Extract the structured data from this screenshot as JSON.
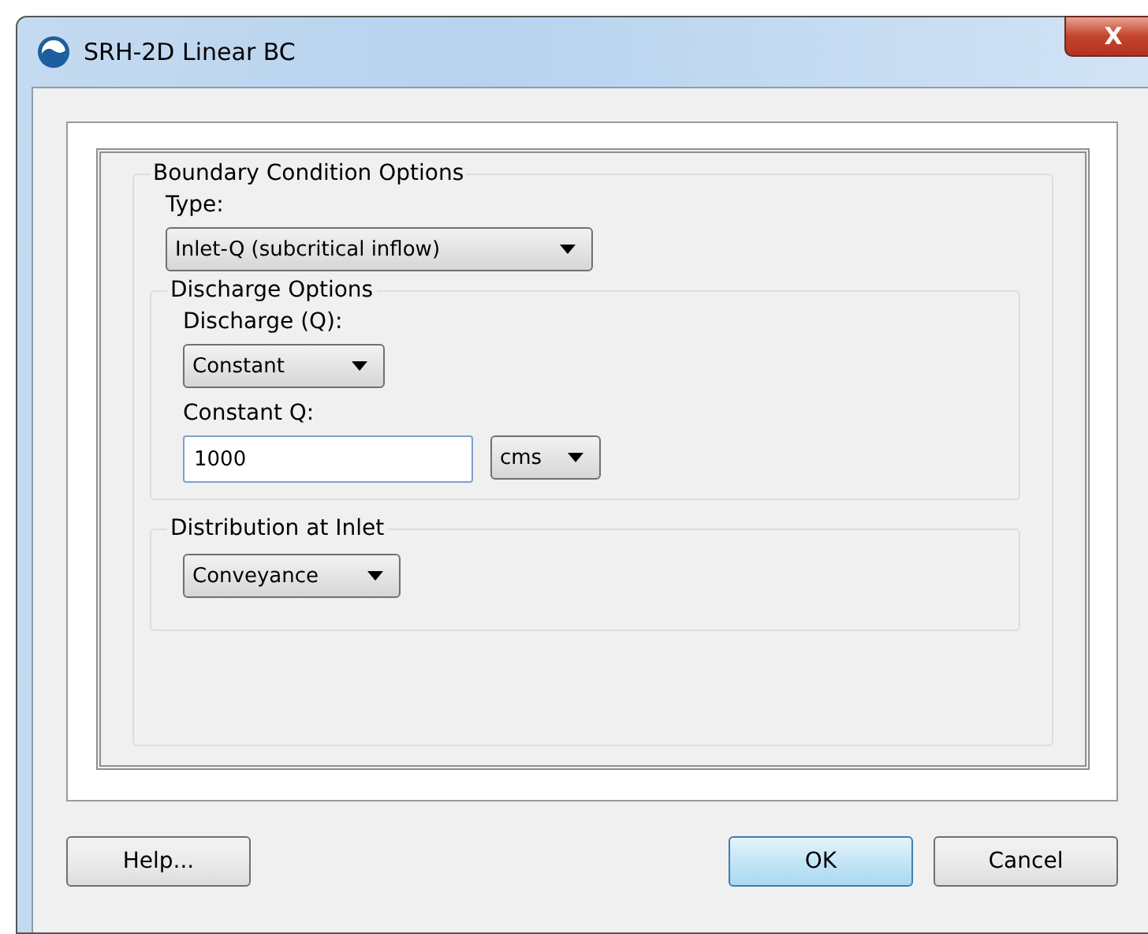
{
  "window": {
    "title": "SRH-2D Linear BC",
    "close": "X"
  },
  "boundary_group": {
    "title": "Boundary Condition Options",
    "type_label": "Type:",
    "type_value": "Inlet-Q (subcritical inflow)",
    "discharge_group": {
      "title": "Discharge Options",
      "discharge_label": "Discharge (Q):",
      "discharge_value": "Constant",
      "constant_label": "Constant Q:",
      "constant_value": "1000",
      "unit_value": "cms"
    },
    "distribution_group": {
      "title": "Distribution at Inlet",
      "distribution_value": "Conveyance"
    }
  },
  "buttons": [
    {
      "label": "Help...",
      "default": false
    },
    {
      "label": "OK",
      "default": true
    },
    {
      "label": "Cancel",
      "default": false
    }
  ]
}
